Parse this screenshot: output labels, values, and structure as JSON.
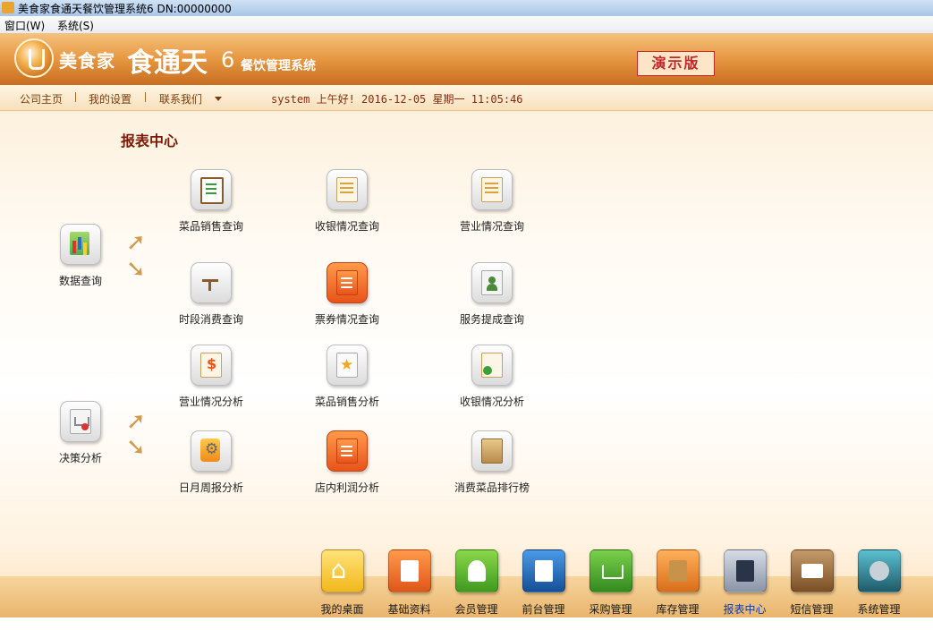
{
  "window": {
    "title": "美食家食通天餐饮管理系统6 DN:00000000"
  },
  "menu": {
    "items": [
      "窗口(W)",
      "系统(S)"
    ]
  },
  "banner": {
    "brand": "美食家",
    "brand_big": "食通天",
    "brand_num": "6",
    "brand_sub": "餐饮管理系统",
    "demo_stamp": "演示版"
  },
  "nav": {
    "links": [
      "公司主页",
      "我的设置",
      "联系我们"
    ],
    "status": "system 上午好! 2016-12-05 星期一 11:05:46"
  },
  "report_center": {
    "title": "报表中心",
    "groups": [
      {
        "label": "数据查询",
        "icon": "data-query-icon"
      },
      {
        "label": "决策分析",
        "icon": "decision-analysis-icon"
      }
    ],
    "items": [
      {
        "label": "菜品销售查询",
        "icon": "clipboard-icon"
      },
      {
        "label": "收银情况查询",
        "icon": "cashier-doc-icon"
      },
      {
        "label": "营业情况查询",
        "icon": "business-doc-icon"
      },
      {
        "label": "时段消费查询",
        "icon": "desk-icon"
      },
      {
        "label": "票券情况查询",
        "icon": "ticket-doc-icon"
      },
      {
        "label": "服务提成查询",
        "icon": "service-person-icon"
      },
      {
        "label": "营业情况分析",
        "icon": "money-doc-icon"
      },
      {
        "label": "菜品销售分析",
        "icon": "star-doc-icon"
      },
      {
        "label": "收银情况分析",
        "icon": "cashier-analysis-icon"
      },
      {
        "label": "日月周报分析",
        "icon": "folder-gear-icon"
      },
      {
        "label": "店内利润分析",
        "icon": "profit-arrow-icon"
      },
      {
        "label": "消费菜品排行榜",
        "icon": "ranking-box-icon"
      }
    ]
  },
  "dock": {
    "items": [
      {
        "label": "我的桌面",
        "icon": "home-icon",
        "color": "#f2c21a"
      },
      {
        "label": "基础资料",
        "icon": "doc-icon",
        "color": "#e86b1a"
      },
      {
        "label": "会员管理",
        "icon": "member-icon",
        "color": "#5bb52a"
      },
      {
        "label": "前台管理",
        "icon": "frontdesk-icon",
        "color": "#1f6fb8"
      },
      {
        "label": "采购管理",
        "icon": "cart-icon",
        "color": "#48a832"
      },
      {
        "label": "库存管理",
        "icon": "inventory-icon",
        "color": "#e88a2a"
      },
      {
        "label": "报表中心",
        "icon": "report-icon",
        "color": "#9aa4b4"
      },
      {
        "label": "短信管理",
        "icon": "mail-icon",
        "color": "#9a6a3a"
      },
      {
        "label": "系统管理",
        "icon": "settings-icon",
        "color": "#2a8a9a"
      }
    ],
    "active": "报表中心"
  }
}
